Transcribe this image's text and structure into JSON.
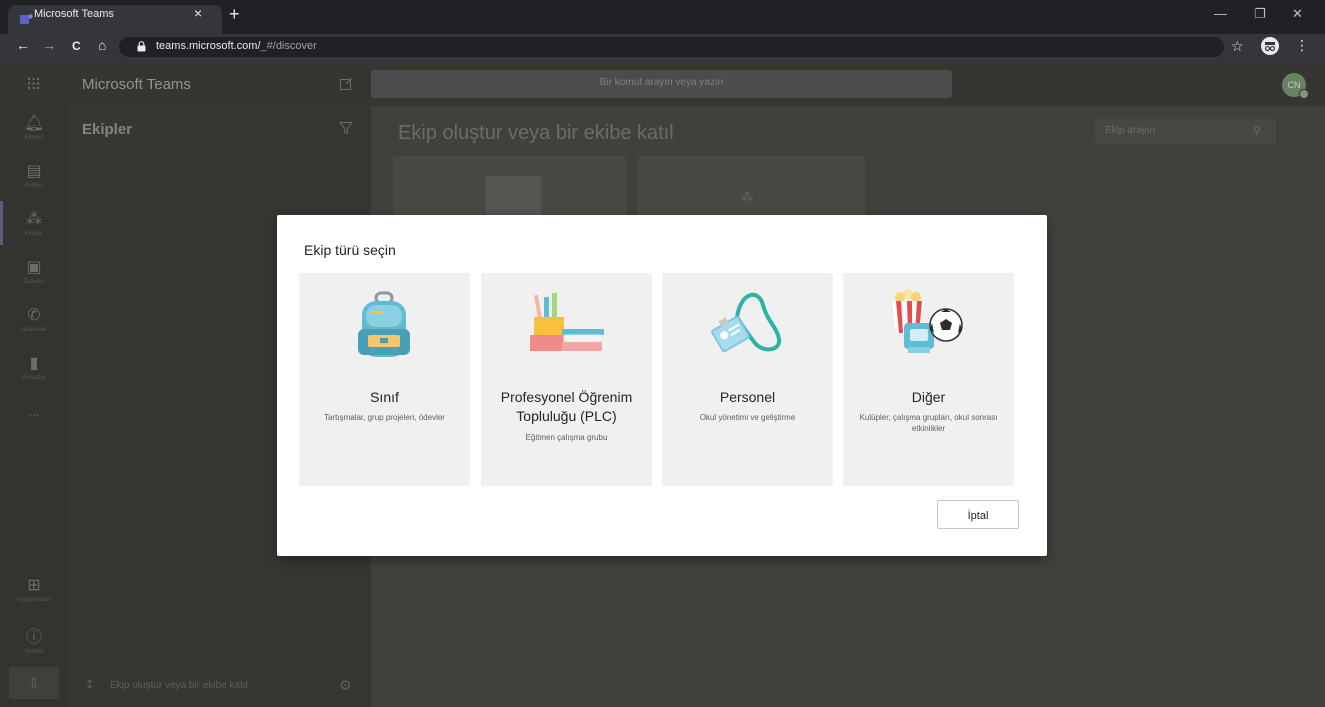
{
  "browser": {
    "tab_title": "Microsoft Teams",
    "tab_close": "×",
    "new_tab": "+",
    "url_host": "teams.microsoft.com/",
    "url_path": "_#/discover",
    "nav": {
      "back": "←",
      "forward": "→",
      "reload": "C",
      "home": "⌂"
    },
    "window": {
      "minimize": "—",
      "restore": "❐",
      "close": "✕"
    },
    "bookmark": "☆",
    "menu": "⋮"
  },
  "header": {
    "app_title": "Microsoft Teams",
    "command_placeholder": "Bir komut arayın veya yazın",
    "avatar_initials": "CN"
  },
  "rail": {
    "items": [
      {
        "label": "Etkinlik",
        "icon": "bell-icon"
      },
      {
        "label": "Sohbet",
        "icon": "chat-icon"
      },
      {
        "label": "Ekipler",
        "icon": "teams-icon"
      },
      {
        "label": "Ödevler",
        "icon": "assignments-icon"
      },
      {
        "label": "Aramalar",
        "icon": "phone-icon"
      },
      {
        "label": "Dosyalar",
        "icon": "files-icon"
      }
    ],
    "more": "...",
    "apps_label": "Uygulamalar",
    "help_label": "Yardım"
  },
  "pane": {
    "title": "Ekipler",
    "footer_text": "Ekip oluştur veya bir ekibe katıl"
  },
  "main": {
    "title": "Ekip oluştur veya bir ekibe katıl",
    "search_placeholder": "Ekip arayın"
  },
  "dialog": {
    "title": "Ekip türü seçin",
    "cards": [
      {
        "title": "Sınıf",
        "desc": "Tartışmalar, grup projeleri, ödevler",
        "icon": "backpack-icon"
      },
      {
        "title": "Profesyonel Öğrenim Topluluğu (PLC)",
        "desc": "Eğitmen çalışma grubu",
        "icon": "books-pencils-icon"
      },
      {
        "title": "Personel",
        "desc": "Okul yönetimi ve geliştirme",
        "icon": "badge-lanyard-icon"
      },
      {
        "title": "Diğer",
        "desc": "Kulüpler, çalışma grupları, okul sonrası etkinlikler",
        "icon": "popcorn-ball-icon"
      }
    ],
    "cancel_label": "İptal"
  },
  "colors": {
    "accent": "#6264a7",
    "dialog_bg": "#ffffff",
    "card_bg": "#f0f0f0"
  }
}
